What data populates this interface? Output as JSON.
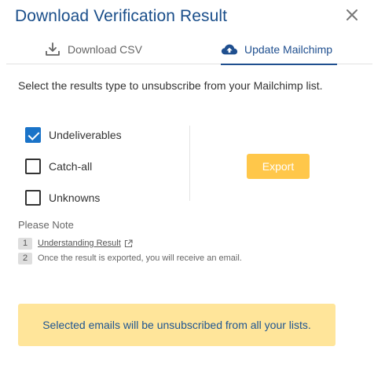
{
  "dialog": {
    "title": "Download Verification Result"
  },
  "tabs": [
    {
      "label": "Download CSV",
      "icon": "download-icon",
      "active": false
    },
    {
      "label": "Update Mailchimp",
      "icon": "cloud-upload-icon",
      "active": true
    }
  ],
  "main": {
    "instruction": "Select the results type to unsubscribe from your Mailchimp list.",
    "options": [
      {
        "label": "Undeliverables",
        "checked": true
      },
      {
        "label": "Catch-all",
        "checked": false
      },
      {
        "label": "Unknowns",
        "checked": false
      }
    ],
    "export_label": "Export"
  },
  "note": {
    "title": "Please Note",
    "items": [
      {
        "num": "1",
        "text": "Understanding Result",
        "icon": "external-link-icon"
      },
      {
        "num": "2",
        "text": "Once the result is exported, you will receive an email."
      }
    ]
  },
  "banner": {
    "text": "Selected emails will be unsubscribed from all your lists."
  },
  "colors": {
    "primary": "#1a73c8",
    "title": "#1a4e8a",
    "export_button": "#ffc74a",
    "banner_bg": "#ffe59a",
    "banner_text": "#1f5591"
  }
}
